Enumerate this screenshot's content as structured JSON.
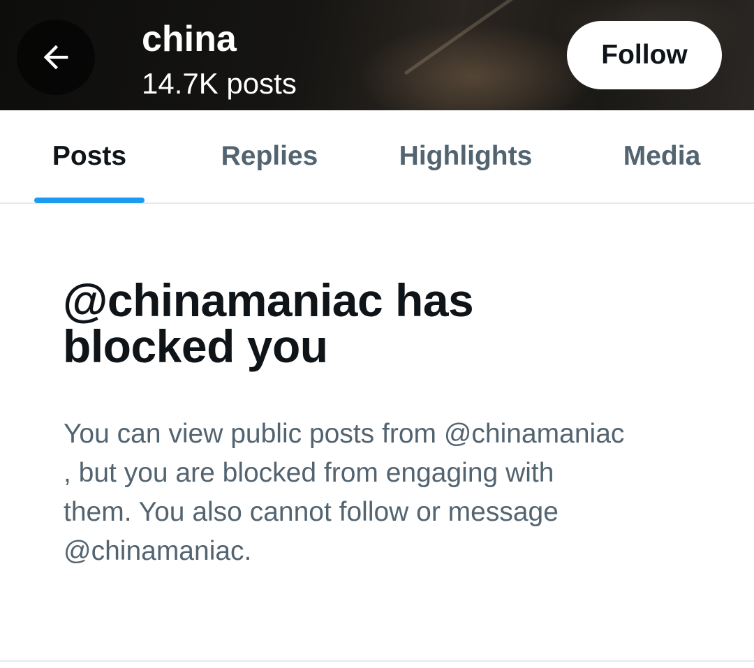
{
  "header": {
    "profile_name": "china",
    "post_count": "14.7K posts",
    "follow_label": "Follow",
    "back_icon": "arrow-left-icon"
  },
  "tabs": [
    {
      "label": "Posts",
      "active": true
    },
    {
      "label": "Replies",
      "active": false
    },
    {
      "label": "Highlights",
      "active": false
    },
    {
      "label": "Media",
      "active": false
    }
  ],
  "blocked_notice": {
    "title_line_1": "@chinamaniac has",
    "title_line_2": "blocked you",
    "body_line_1": "You can view public posts from @chinamaniac",
    "body_line_2": ", but you are blocked from engaging with",
    "body_line_3": "them. You also cannot follow or message",
    "body_line_4": "@chinamaniac."
  },
  "colors": {
    "accent": "#1d9bf0",
    "text_primary": "#0f1419",
    "text_secondary": "#536471"
  }
}
